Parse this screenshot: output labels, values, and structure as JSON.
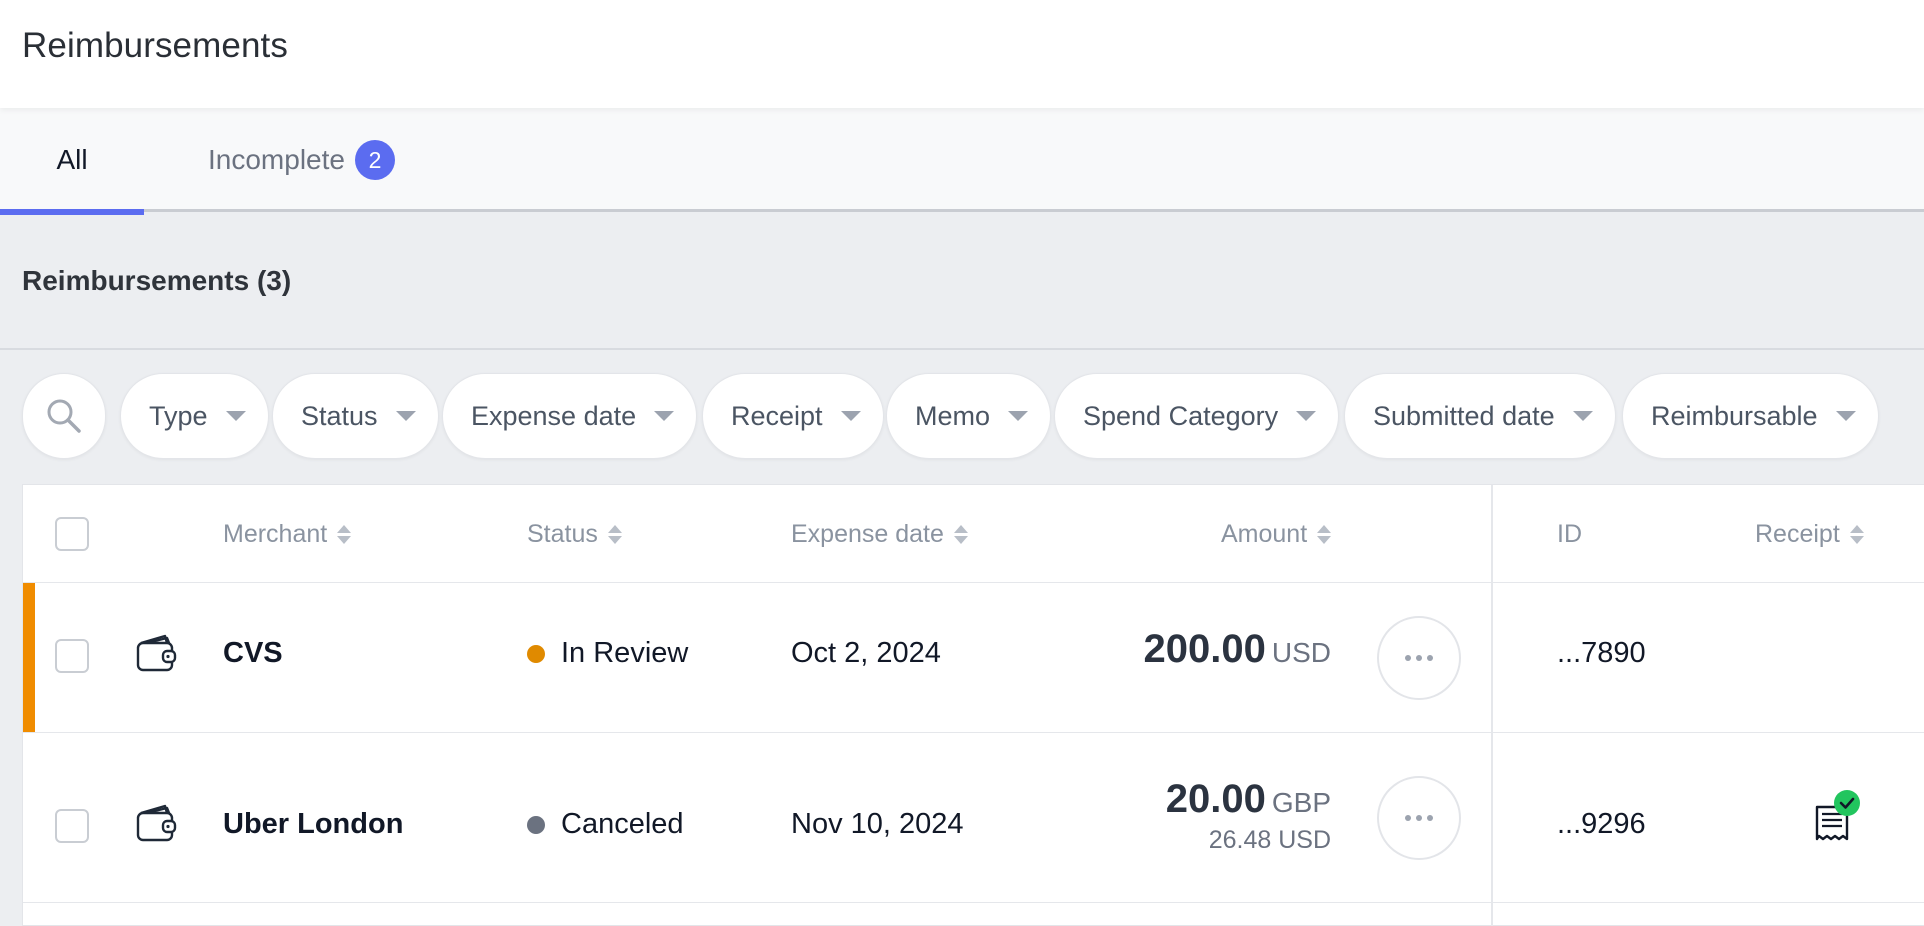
{
  "header": {
    "title": "Reimbursements"
  },
  "tabs": [
    {
      "label": "All",
      "active": true
    },
    {
      "label": "Incomplete",
      "badge": "2"
    }
  ],
  "section": {
    "title": "Reimbursements (3)"
  },
  "filters": {
    "search_icon": "search-icon",
    "pills": [
      "Type",
      "Status",
      "Expense date",
      "Receipt",
      "Memo",
      "Spend Category",
      "Submitted date",
      "Reimbursable"
    ]
  },
  "table": {
    "columns": {
      "merchant": "Merchant",
      "status": "Status",
      "expense_date": "Expense date",
      "amount": "Amount",
      "id": "ID",
      "receipt": "Receipt"
    },
    "rows": [
      {
        "icon": "wallet-icon",
        "merchant": "CVS",
        "status": "In Review",
        "status_color": "#e08a00",
        "expense_date": "Oct 2, 2024",
        "amount": "200.00",
        "currency": "USD",
        "converted": "",
        "id": "...7890",
        "receipt": "",
        "accent": "#f08c00"
      },
      {
        "icon": "wallet-icon",
        "merchant": "Uber London",
        "status": "Canceled",
        "status_color": "#6b7280",
        "expense_date": "Nov 10, 2024",
        "amount": "20.00",
        "currency": "GBP",
        "converted": "26.48 USD",
        "id": "...9296",
        "receipt": "receipt-verified-icon"
      }
    ]
  },
  "colors": {
    "accent": "#5b6cf0",
    "warning": "#f08c00",
    "success": "#22c55e"
  }
}
